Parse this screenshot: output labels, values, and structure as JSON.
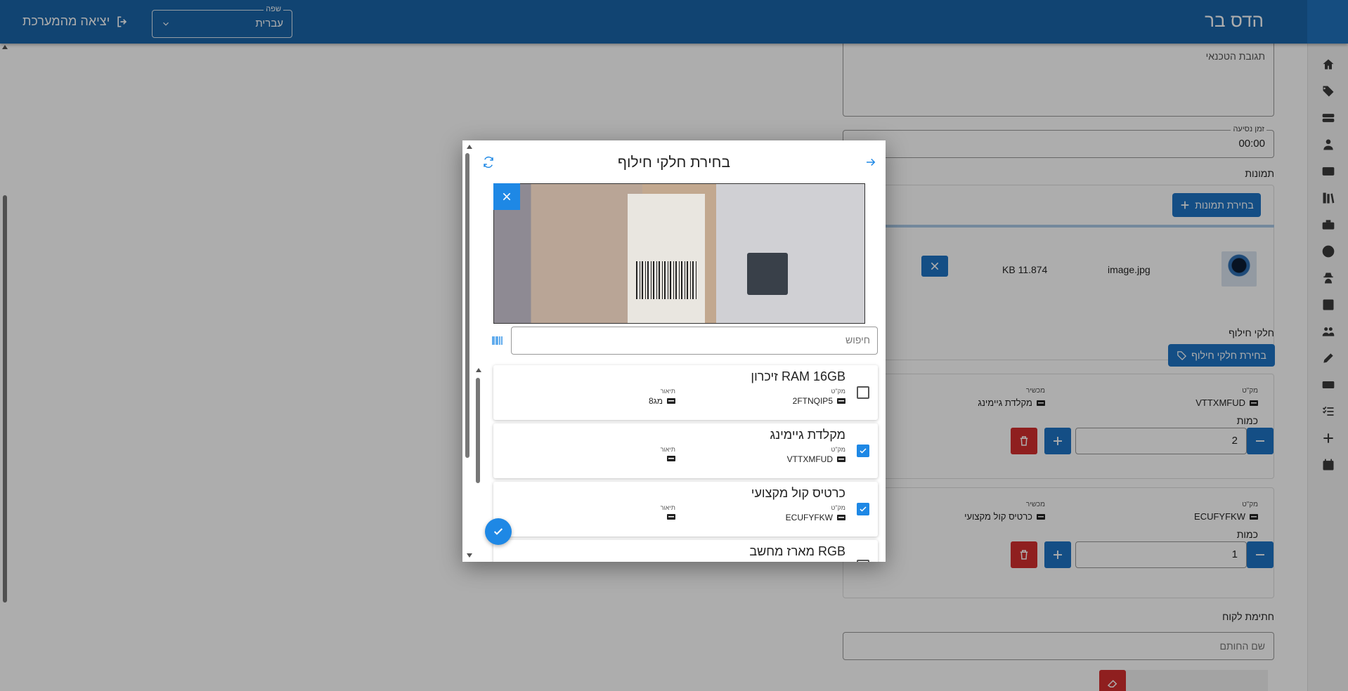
{
  "header": {
    "app_title": "הדס בר",
    "language": {
      "label": "שפה",
      "value": "עברית"
    },
    "logout_label": "יציאה מהמערכת"
  },
  "sidebar": {
    "icons": [
      "home-icon",
      "tag-icon",
      "storage-icon",
      "user-icon",
      "card-icon",
      "books-icon",
      "toolbox-icon",
      "globe-icon",
      "spy-icon",
      "media-icon",
      "users-icon",
      "edit-icon",
      "ticket-icon",
      "checklist-icon",
      "plus-icon",
      "calendar-icon"
    ]
  },
  "form": {
    "tech_response_placeholder": "תגובת הטכנאי",
    "travel_time": {
      "label": "זמן נסיעה",
      "value": "00:00"
    },
    "photos": {
      "section_title": "תמונות",
      "select_button": "בחירת תמונות",
      "file_name": "image.jpg",
      "file_size": "KB 11.874"
    },
    "parts": {
      "section_title": "חלקי חילוף",
      "select_button": "בחירת חלקי חילוף",
      "items": [
        {
          "sku_label": "מק\"ט",
          "sku": "VTTXMFUD",
          "device_label": "מכשיר",
          "device": "מקלדת גיימינג",
          "qty_label": "כמות",
          "qty": "2"
        },
        {
          "sku_label": "מק\"ט",
          "sku": "ECUFYFKW",
          "device_label": "מכשיר",
          "device": "כרטיס קול מקצועי",
          "qty_label": "כמות",
          "qty": "1"
        }
      ]
    },
    "signature": {
      "section_title": "חתימת לקוח",
      "signer_placeholder": "שם החותם"
    }
  },
  "modal": {
    "title": "בחירת חלקי חילוף",
    "search_placeholder": "חיפוש",
    "items": [
      {
        "name": "זיכרון RAM 16GB",
        "sku_label": "מק\"ט",
        "sku": "2FTNQIP5",
        "desc_label": "תיאור",
        "desc": "8מג",
        "checked": false
      },
      {
        "name": "מקלדת גיימינג",
        "sku_label": "מק\"ט",
        "sku": "VTTXMFUD",
        "desc_label": "תיאור",
        "desc": "",
        "checked": true
      },
      {
        "name": "כרטיס קול מקצועי",
        "sku_label": "מק\"ט",
        "sku": "ECUFYFKW",
        "desc_label": "תיאור",
        "desc": "",
        "checked": true
      },
      {
        "name": "מארז מחשב RGB",
        "checked": false
      }
    ]
  },
  "colors": {
    "primary": "#1a65a8",
    "accent": "#1e88e5",
    "danger": "#d32f2f"
  }
}
